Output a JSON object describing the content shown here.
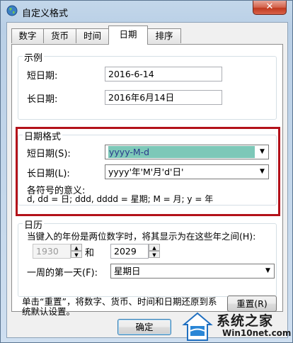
{
  "window": {
    "title": "自定义格式",
    "close_label": "✕"
  },
  "tabs": [
    {
      "label": "数字",
      "active": false
    },
    {
      "label": "货币",
      "active": false
    },
    {
      "label": "时间",
      "active": false
    },
    {
      "label": "日期",
      "active": true
    },
    {
      "label": "排序",
      "active": false
    }
  ],
  "example": {
    "group_label": "示例",
    "short_date_label": "短日期:",
    "short_date_value": "2016-6-14",
    "long_date_label": "长日期:",
    "long_date_value": "2016年6月14日"
  },
  "date_format": {
    "group_label": "日期格式",
    "short_date_label": "短日期(S):",
    "short_date_value": "yyyy-M-d",
    "long_date_label": "长日期(L):",
    "long_date_value": "yyyy'年'M'月'd'日'",
    "symbols_title": "各符号的意义:",
    "symbols_text": "d, dd = 日;  ddd, dddd = 星期;  M = 月;  y = 年"
  },
  "calendar": {
    "group_label": "日历",
    "two_digit_label": "当键入的年份是两位数字时，将其显示为在这些年之间(H):",
    "year_from": "1930",
    "and_label": "和",
    "year_to": "2029",
    "first_day_label": "一周的第一天(F):",
    "first_day_value": "星期日"
  },
  "reset": {
    "description": "单击“重置”，将数字、货币、时间和日期还原到系统默认设置。",
    "button_label": "重置(R)"
  },
  "footer": {
    "ok_label": "确定"
  },
  "watermark": {
    "title": "系统之家",
    "url": "Win10net.com"
  },
  "colors": {
    "highlight_border": "#b3111a",
    "selection_bg": "#7dc8b8"
  }
}
